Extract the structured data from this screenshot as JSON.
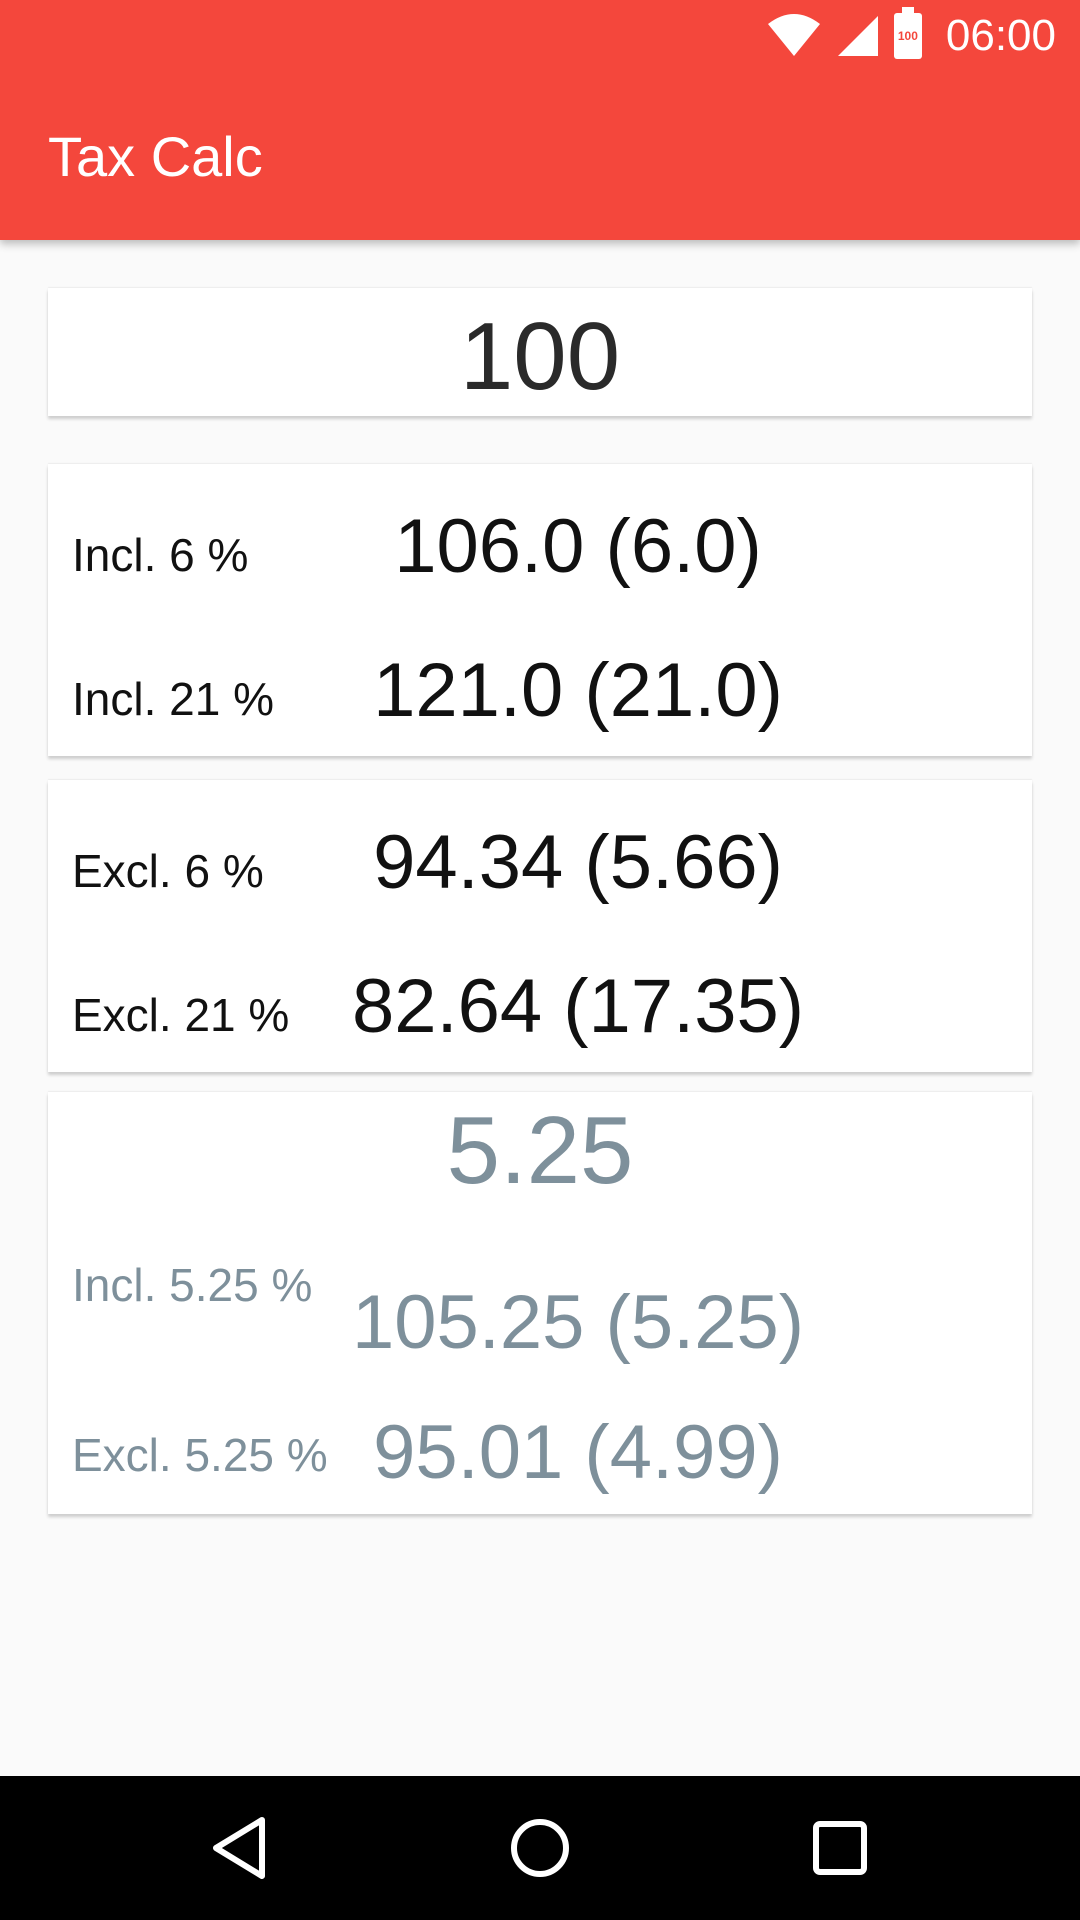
{
  "status_bar": {
    "time": "06:00",
    "battery_level": "100",
    "icons": [
      "wifi-icon",
      "cell-signal-icon",
      "battery-icon"
    ]
  },
  "app_bar": {
    "title": "Tax Calc",
    "color": "#f4473c"
  },
  "amount": "100",
  "including": [
    {
      "label": "Incl. 6 %",
      "value": "106.0 (6.0)"
    },
    {
      "label": "Incl. 21 %",
      "value": "121.0 (21.0)"
    }
  ],
  "excluding": [
    {
      "label": "Excl. 6 %",
      "value": "94.34 (5.66)"
    },
    {
      "label": "Excl. 21 %",
      "value": "82.64 (17.35)"
    }
  ],
  "custom": {
    "rate": "5.25",
    "incl": {
      "label": "Incl. 5.25 %",
      "value": "105.25 (5.25)"
    },
    "excl": {
      "label": "Excl. 5.25 %",
      "value": "95.01 (4.99)"
    },
    "color": "#7e909b"
  },
  "nav_bar": {
    "buttons": [
      "back-icon",
      "home-icon",
      "recents-icon"
    ]
  }
}
